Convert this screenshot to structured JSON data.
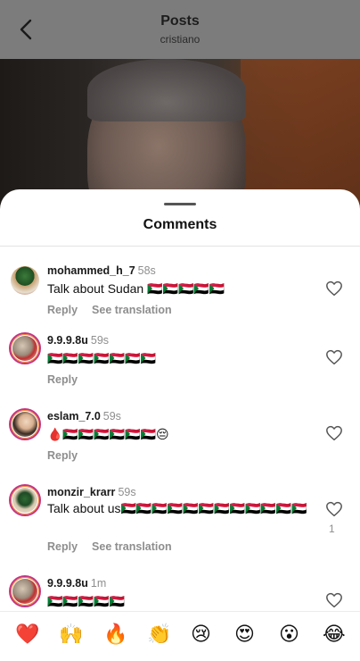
{
  "header": {
    "title": "Posts",
    "subtitle": "cristiano"
  },
  "sheet": {
    "title": "Comments"
  },
  "comments": [
    {
      "username": "mohammed_h_7",
      "time": "58s",
      "text": "Talk about Sudan 🇸🇩🇸🇩🇸🇩🇸🇩🇸🇩",
      "reply": "Reply",
      "translate": "See translation",
      "likes": ""
    },
    {
      "username": "9.9.9.8u",
      "time": "59s",
      "text": "🇸🇩🇸🇩🇸🇩🇸🇩🇸🇩🇸🇩🇸🇩",
      "reply": "Reply",
      "translate": "",
      "likes": ""
    },
    {
      "username": "eslam_7.0",
      "time": "59s",
      "text": "🩸🇸🇩🇸🇩🇸🇩🇸🇩🇸🇩🇸🇩😔",
      "reply": "Reply",
      "translate": "",
      "likes": ""
    },
    {
      "username": "monzir_krarr",
      "time": "59s",
      "text": "Talk about us🇸🇩🇸🇩🇸🇩🇸🇩🇸🇩🇸🇩🇸🇩🇸🇩🇸🇩🇸🇩🇸🇩🇸🇩",
      "reply": "Reply",
      "translate": "See translation",
      "likes": "1"
    },
    {
      "username": "9.9.9.8u",
      "time": "1m",
      "text": "🇸🇩🇸🇩🇸🇩🇸🇩🇸🇩",
      "reply": "",
      "translate": "",
      "likes": ""
    }
  ],
  "reactions": [
    "❤️",
    "🙌",
    "🔥",
    "👏",
    "😢",
    "😍",
    "😮",
    "😂"
  ]
}
